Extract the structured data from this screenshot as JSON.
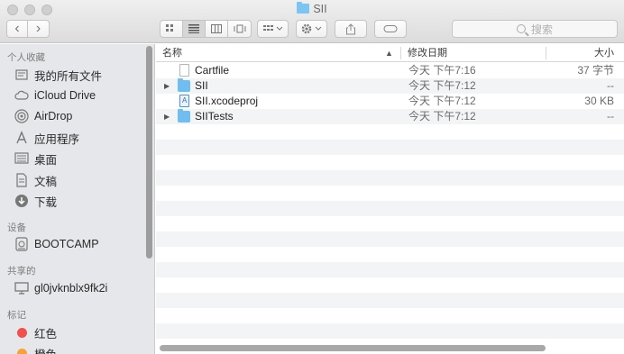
{
  "window": {
    "title": "SII"
  },
  "search": {
    "placeholder": "搜索"
  },
  "toolbar": {
    "back": "‹",
    "forward": "›"
  },
  "sidebar": {
    "favorites_header": "个人收藏",
    "favorites": [
      {
        "label": "我的所有文件",
        "icon": "all-files-icon"
      },
      {
        "label": "iCloud Drive",
        "icon": "cloud-icon"
      },
      {
        "label": "AirDrop",
        "icon": "airdrop-icon"
      },
      {
        "label": "应用程序",
        "icon": "applications-icon"
      },
      {
        "label": "桌面",
        "icon": "desktop-icon"
      },
      {
        "label": "文稿",
        "icon": "documents-icon"
      },
      {
        "label": "下载",
        "icon": "download-icon"
      }
    ],
    "devices_header": "设备",
    "devices": [
      {
        "label": "BOOTCAMP",
        "icon": "disk-icon"
      }
    ],
    "shared_header": "共享的",
    "shared": [
      {
        "label": "gl0jvknblx9fk2i",
        "icon": "computer-icon"
      }
    ],
    "tags_header": "标记",
    "tags": [
      {
        "label": "红色",
        "color": "#f0504c"
      },
      {
        "label": "橙色",
        "color": "#f6a23a"
      }
    ]
  },
  "list": {
    "columns": {
      "name": "名称",
      "date": "修改日期",
      "size": "大小"
    },
    "files": [
      {
        "name": "Cartfile",
        "date": "今天 下午7:16",
        "size": "37 字节",
        "kind": "document"
      },
      {
        "name": "SII",
        "date": "今天 下午7:12",
        "size": "--",
        "kind": "folder"
      },
      {
        "name": "SII.xcodeproj",
        "date": "今天 下午7:12",
        "size": "30 KB",
        "kind": "xcodeproj"
      },
      {
        "name": "SIITests",
        "date": "今天 下午7:12",
        "size": "--",
        "kind": "folder"
      }
    ]
  },
  "colors": {
    "folder": "#6fbdf1",
    "sidebar_bg": "#e6e7ea"
  }
}
